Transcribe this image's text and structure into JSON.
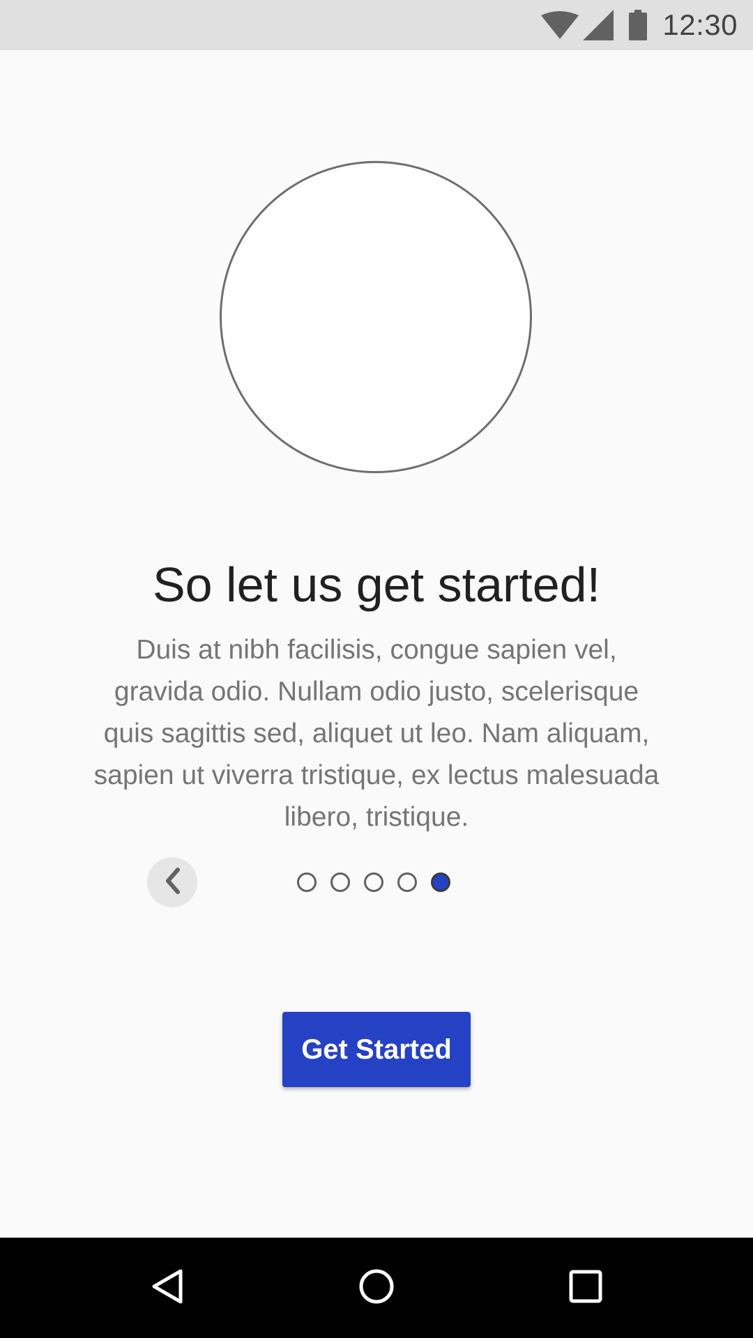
{
  "status_bar": {
    "time": "12:30",
    "icons": [
      "wifi-icon",
      "cellular-signal-icon",
      "battery-icon"
    ]
  },
  "onboarding": {
    "title": "So let us get started!",
    "description": "Duis at nibh facilisis, congue sapien vel, gravida odio. Nullam odio justo, scelerisque quis sagittis sed, aliquet ut leo. Nam aliquam, sapien ut viverra tristique, ex lectus malesuada libero, tristique.",
    "page_indicator": {
      "total": 5,
      "current": 5
    },
    "back_icon": "chevron-left-icon",
    "cta_label": "Get Started"
  },
  "nav_bar": {
    "icons": [
      "back-triangle-icon",
      "home-circle-icon",
      "recents-square-icon"
    ]
  },
  "colors": {
    "accent": "#2541c4",
    "background": "#fafafa",
    "status_bar": "#e0e0e0",
    "nav_bar": "#000000"
  }
}
